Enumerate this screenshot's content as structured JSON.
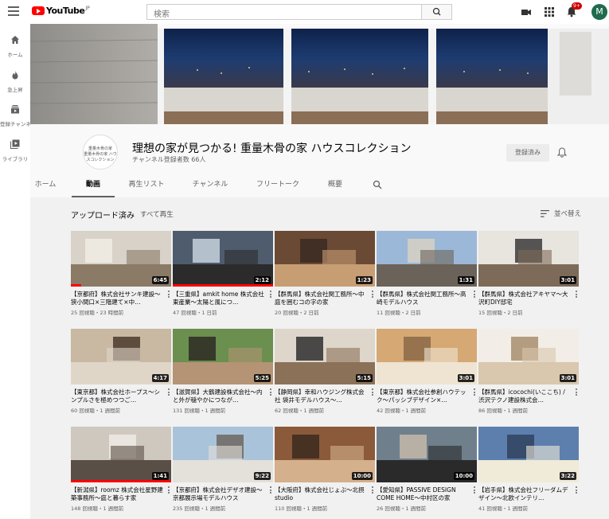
{
  "topbar": {
    "logo_text": "YouTube",
    "logo_region": "JP",
    "search_placeholder": "検索",
    "notification_count": "9+",
    "avatar_letter": "M"
  },
  "sidebar": {
    "items": [
      {
        "label": "ホーム",
        "icon": "home-icon"
      },
      {
        "label": "急上昇",
        "icon": "trending-icon"
      },
      {
        "label": "登録チャンネル",
        "icon": "subscriptions-icon"
      },
      {
        "label": "ライブラリ",
        "icon": "library-icon"
      }
    ]
  },
  "channel": {
    "avatar_text_1": "重量木骨の家",
    "avatar_text_2": "重量木骨の家 ハウスコレクション",
    "title": "理想の家が見つかる! 重量木骨の家 ハウスコレクション",
    "subscribers": "チャンネル登録者数 66人",
    "subscribe_label": "登録済み"
  },
  "tabs": [
    {
      "label": "ホーム",
      "active": false
    },
    {
      "label": "動画",
      "active": true
    },
    {
      "label": "再生リスト",
      "active": false
    },
    {
      "label": "チャンネル",
      "active": false
    },
    {
      "label": "フリートーク",
      "active": false
    },
    {
      "label": "概要",
      "active": false
    }
  ],
  "section": {
    "title": "アップロード済み",
    "play_all": "すべて再生",
    "sort_label": "並べ替え"
  },
  "videos": [
    {
      "title": "【京都府】株式会社サンキ建設～狭小間口×三階建て×中…",
      "meta": "25 回視聴・23 時間前",
      "duration": "6:45",
      "progress": 0.1,
      "colors": [
        "#d8d2c8",
        "#8a7a66",
        "#f1ece4"
      ]
    },
    {
      "title": "【三重県】amkit home 株式会社東産業～太陽と風につ…",
      "meta": "47 回視聴・1 日前",
      "duration": "2:12",
      "progress": 1.0,
      "colors": [
        "#4e5c6e",
        "#2b2b2b",
        "#c7d2de"
      ]
    },
    {
      "title": "【群馬県】株式会社関工務所～中庭を囲むコの字の家",
      "meta": "20 回視聴・2 日前",
      "duration": "1:23",
      "progress": 0,
      "colors": [
        "#6b4a35",
        "#c79d74",
        "#3a2a22"
      ]
    },
    {
      "title": "【群馬県】株式会社関工務所～高崎モデルハウス",
      "meta": "11 回視聴・2 日前",
      "duration": "1:31",
      "progress": 0,
      "colors": [
        "#9cb8d8",
        "#6b6259",
        "#d8d0c4"
      ]
    },
    {
      "title": "【群馬県】株式会社アキヤマ～大沢町DIY邸宅",
      "meta": "15 回視聴・2 日前",
      "duration": "3:01",
      "progress": 0,
      "colors": [
        "#e8e4de",
        "#7d6a58",
        "#3b3b3b"
      ]
    },
    {
      "title": "【東京都】株式会社ホープス～シンプルさを極めつつご…",
      "meta": "60 回視聴・1 週間前",
      "duration": "4:17",
      "progress": 0,
      "colors": [
        "#c9b8a2",
        "#e0d6c8",
        "#4b3a2d"
      ]
    },
    {
      "title": "【滋賀県】大鶴建設株式会社～内と外が穏やかにつなが…",
      "meta": "131 回視聴・1 週間前",
      "duration": "5:25",
      "progress": 0,
      "colors": [
        "#6b8f4e",
        "#b49474",
        "#2e2a26"
      ]
    },
    {
      "title": "【静岡県】幸和ハウジング株式会社 袋井モデルハウス～…",
      "meta": "62 回視聴・1 週間前",
      "duration": "5:15",
      "progress": 0,
      "colors": [
        "#ded6cb",
        "#8b7158",
        "#2f2f2f"
      ]
    },
    {
      "title": "【東京都】株式会社参創ハウテック～パッシブデザイン×…",
      "meta": "42 回視聴・1 週間前",
      "duration": "3:01",
      "progress": 0,
      "colors": [
        "#d6a874",
        "#efe4d2",
        "#8b6a48"
      ]
    },
    {
      "title": "【群馬県】icocochi(いここち) / 渋沢テクノ建設株式会…",
      "meta": "86 回視聴・1 週間前",
      "duration": "3:01",
      "progress": 0,
      "colors": [
        "#f2ede6",
        "#d9c7ae",
        "#a88d6d"
      ]
    },
    {
      "title": "【新潟県】roomz 株式会社星野建築事務所～庭と暮らす家",
      "meta": "148 回視聴・1 週間前",
      "duration": "1:41",
      "progress": 1.0,
      "colors": [
        "#cfc8bf",
        "#5a4f46",
        "#eeeae4"
      ]
    },
    {
      "title": "【京都府】株式会社デザオ建設～京都展示場モデルハウス",
      "meta": "235 回視聴・1 週間前",
      "duration": "9:22",
      "progress": 0,
      "colors": [
        "#a9c3da",
        "#e4e0da",
        "#6f6760"
      ]
    },
    {
      "title": "【大阪府】株式会社じょぶ～北摂studio",
      "meta": "110 回視聴・1 週間前",
      "duration": "10:00",
      "progress": 0,
      "colors": [
        "#8a5a3a",
        "#d4b08c",
        "#3a2a20"
      ]
    },
    {
      "title": "【愛知県】PASSIVE DESIGN COME HOME～中村区の家",
      "meta": "26 回視聴・1 週間前",
      "duration": "10:00",
      "progress": 0,
      "colors": [
        "#6f7f8c",
        "#2a2a2a",
        "#c6b9a8"
      ]
    },
    {
      "title": "【岩手県】株式会社フリーダムデザイン～北欧インテリ…",
      "meta": "41 回視聴・1 週間前",
      "duration": "3:22",
      "progress": 0,
      "colors": [
        "#5d7fae",
        "#f0ead8",
        "#30425e"
      ]
    }
  ]
}
